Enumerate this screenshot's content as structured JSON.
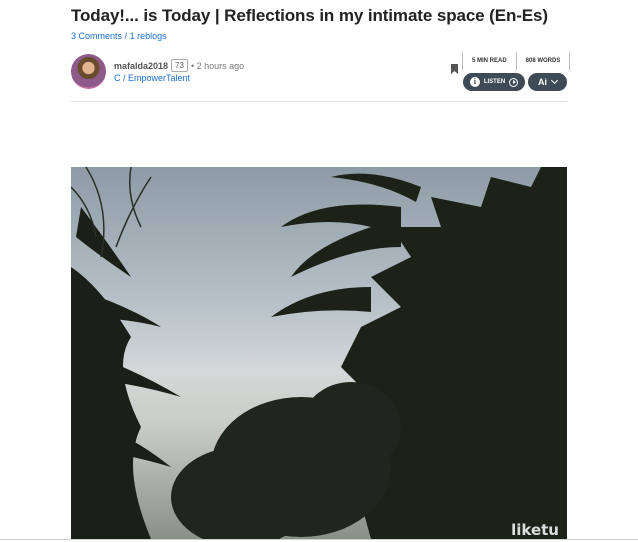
{
  "post": {
    "title": "Today!... is Today | Reflections in my intimate space (En-Es)",
    "comments": "3 Comments",
    "separator": "/",
    "reblogs": "1 reblogs"
  },
  "author": {
    "name": "mafalda2018",
    "reputation": "73",
    "time": "• 2 hours ago",
    "community": "C / EmpowerTalent"
  },
  "stats": {
    "read_time": "5 MIN READ",
    "words": "808 WORDS"
  },
  "toolbar": {
    "listen_label": "LISTEN",
    "ai_label": "Ai"
  },
  "image": {
    "watermark": "liketu"
  }
}
